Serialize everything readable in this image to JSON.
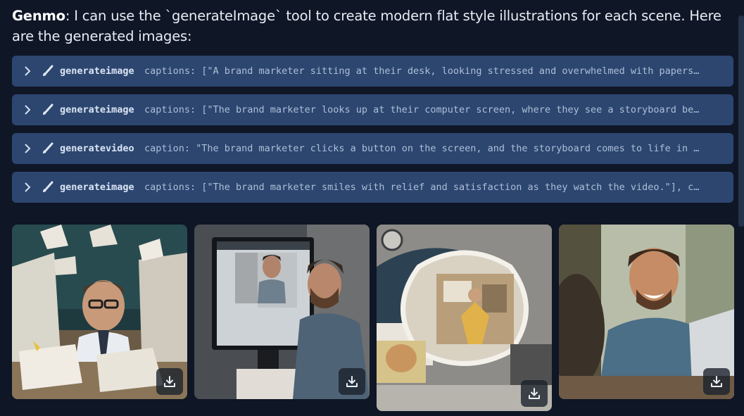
{
  "message": {
    "sender": "Genmo",
    "text": ": I can use the `generateImage` tool to create modern flat style illustrations for each scene. Here are the generated images:"
  },
  "tool_calls": [
    {
      "name": "generateimage",
      "args": "captions: [\"A brand marketer sitting at their desk, looking stressed and overwhelmed with papers…"
    },
    {
      "name": "generateimage",
      "args": "captions: [\"The brand marketer looks up at their computer screen, where they see a storyboard be…"
    },
    {
      "name": "generatevideo",
      "args": "caption: \"The brand marketer clicks a button on the screen, and the storyboard comes to life in …"
    },
    {
      "name": "generateimage",
      "args": "captions: [\"The brand marketer smiles with relief and satisfaction as they watch the video.\"], c…"
    }
  ],
  "icons": {
    "expand": "chevron-right-icon",
    "tool": "paintbrush-icon",
    "download": "download-icon"
  },
  "colors": {
    "background": "#0f1626",
    "tool_row": "#2c4670",
    "text": "#e7ecf4"
  }
}
